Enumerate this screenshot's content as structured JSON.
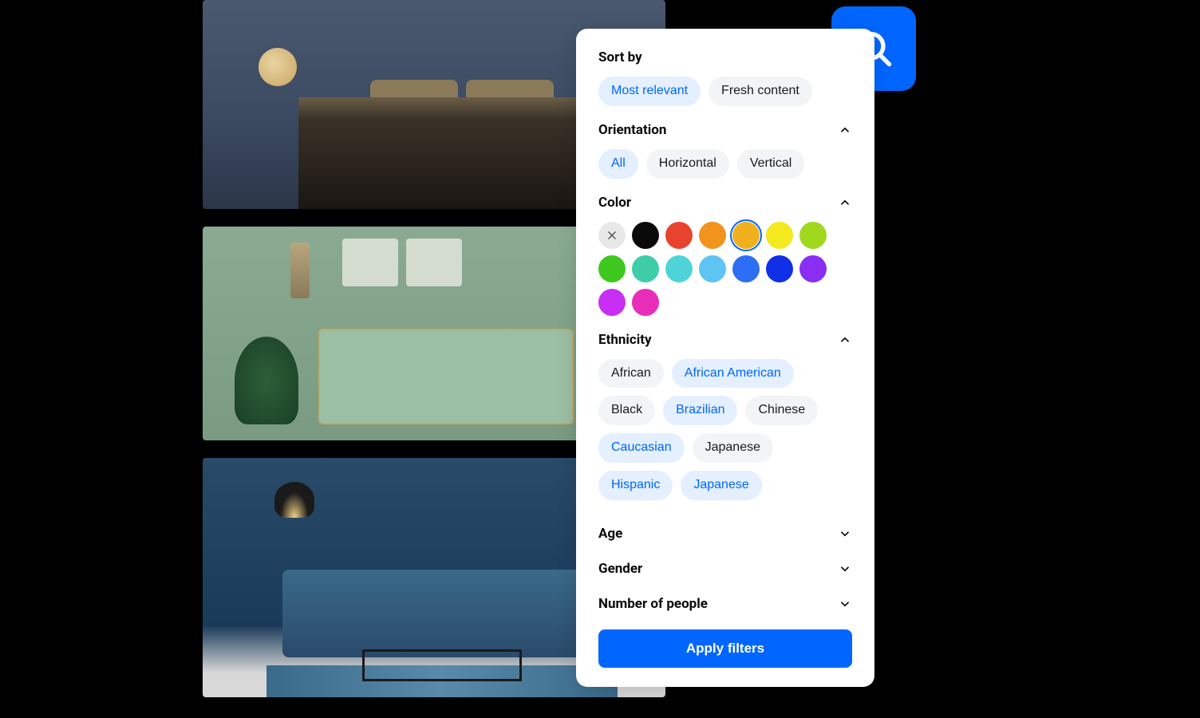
{
  "gallery": {
    "items": [
      {
        "name": "bedroom-dark-blue"
      },
      {
        "name": "living-room-green"
      },
      {
        "name": "living-room-blue"
      }
    ]
  },
  "searchIcon": "search-icon",
  "filters": {
    "sortBy": {
      "title": "Sort by",
      "options": [
        {
          "label": "Most relevant",
          "selected": true
        },
        {
          "label": "Fresh content",
          "selected": false
        }
      ]
    },
    "orientation": {
      "title": "Orientation",
      "expanded": true,
      "options": [
        {
          "label": "All",
          "selected": true
        },
        {
          "label": "Horizontal",
          "selected": false
        },
        {
          "label": "Vertical",
          "selected": false
        }
      ]
    },
    "color": {
      "title": "Color",
      "expanded": true,
      "clearLabel": "clear",
      "swatches": [
        {
          "name": "black",
          "hex": "#0a0a0a",
          "selected": false
        },
        {
          "name": "red",
          "hex": "#e8432e",
          "selected": false
        },
        {
          "name": "orange",
          "hex": "#f0941e",
          "selected": false
        },
        {
          "name": "amber",
          "hex": "#f0b01e",
          "selected": true
        },
        {
          "name": "yellow",
          "hex": "#f4e81e",
          "selected": false
        },
        {
          "name": "lime",
          "hex": "#a0d81e",
          "selected": false
        },
        {
          "name": "green",
          "hex": "#3ec81e",
          "selected": false
        },
        {
          "name": "teal",
          "hex": "#3ecda8",
          "selected": false
        },
        {
          "name": "cyan",
          "hex": "#4ed4d8",
          "selected": false
        },
        {
          "name": "sky",
          "hex": "#5ec4f4",
          "selected": false
        },
        {
          "name": "blue",
          "hex": "#2e6ef4",
          "selected": false
        },
        {
          "name": "indigo",
          "hex": "#1030e8",
          "selected": false
        },
        {
          "name": "violet",
          "hex": "#8a2ef4",
          "selected": false
        },
        {
          "name": "purple",
          "hex": "#c82ef4",
          "selected": false
        },
        {
          "name": "magenta",
          "hex": "#e82eb8",
          "selected": false
        }
      ]
    },
    "ethnicity": {
      "title": "Ethnicity",
      "expanded": true,
      "options": [
        {
          "label": "African",
          "selected": false
        },
        {
          "label": "African American",
          "selected": true
        },
        {
          "label": "Black",
          "selected": false
        },
        {
          "label": "Brazilian",
          "selected": true
        },
        {
          "label": "Chinese",
          "selected": false
        },
        {
          "label": "Caucasian",
          "selected": true
        },
        {
          "label": "Japanese",
          "selected": false
        },
        {
          "label": "Hispanic",
          "selected": true
        },
        {
          "label": "Japanese",
          "selected": true
        }
      ]
    },
    "age": {
      "title": "Age",
      "expanded": false
    },
    "gender": {
      "title": "Gender",
      "expanded": false
    },
    "numberOfPeople": {
      "title": "Number of people",
      "expanded": false
    },
    "applyLabel": "Apply filters"
  }
}
